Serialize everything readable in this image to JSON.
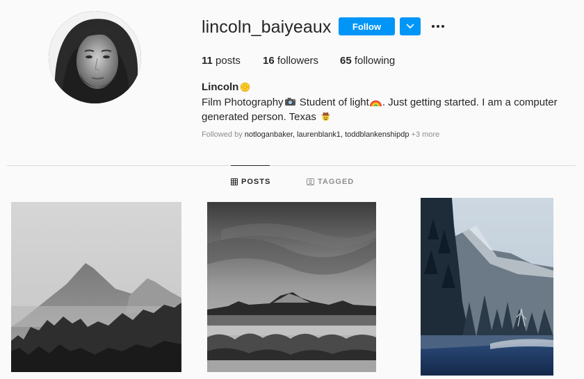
{
  "profile": {
    "username": "lincoln_baiyeaux",
    "follow_label": "Follow",
    "stats": {
      "posts_count": "11",
      "posts_label": "posts",
      "followers_count": "16",
      "followers_label": "followers",
      "following_count": "65",
      "following_label": "following"
    },
    "bio": {
      "name": "Lincoln",
      "line_part1": "Film Photography",
      "line_part2": " Student of light",
      "line_part3": ". Just getting started. I am a computer generated person. Texas "
    },
    "followed_by": {
      "prefix": "Followed by ",
      "names": "notloganbaker, laurenblank1, toddblankenshipdp",
      "suffix": " +3 more"
    }
  },
  "tabs": [
    {
      "label": "POSTS",
      "active": true,
      "icon": "grid-icon"
    },
    {
      "label": "TAGGED",
      "active": false,
      "icon": "tag-icon"
    }
  ],
  "posts": [
    {
      "icon": "mountain-fog-photo"
    },
    {
      "icon": "mountain-lake-photo"
    },
    {
      "icon": "valley-forest-photo"
    }
  ],
  "colors": {
    "accent": "#0095f6",
    "background": "#fafafa",
    "text": "#262626",
    "muted": "#8e8e8e"
  }
}
